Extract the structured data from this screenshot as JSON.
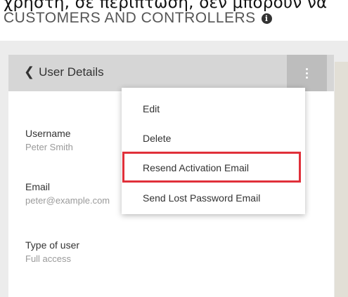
{
  "caption_text": "χρήστη, σε περίπτωση, δεν μπορούν να",
  "section": {
    "title": "CUSTOMERS AND CONTROLLERS",
    "info_glyph": "i"
  },
  "header": {
    "back_label": "User Details",
    "back_chevron": "❮"
  },
  "details": {
    "username_label": "Username",
    "username_value": "Peter Smith",
    "email_label": "Email",
    "email_value": "peter@example.com",
    "type_label": "Type of user",
    "type_value": "Full access"
  },
  "menu": {
    "items": [
      {
        "label": "Edit"
      },
      {
        "label": "Delete"
      },
      {
        "label": "Resend Activation Email"
      },
      {
        "label": "Send Lost Password Email"
      }
    ]
  },
  "colors": {
    "highlight": "#e0303a",
    "header_bg": "#d6d6d6",
    "kebab_bg": "#bdbdbd"
  }
}
